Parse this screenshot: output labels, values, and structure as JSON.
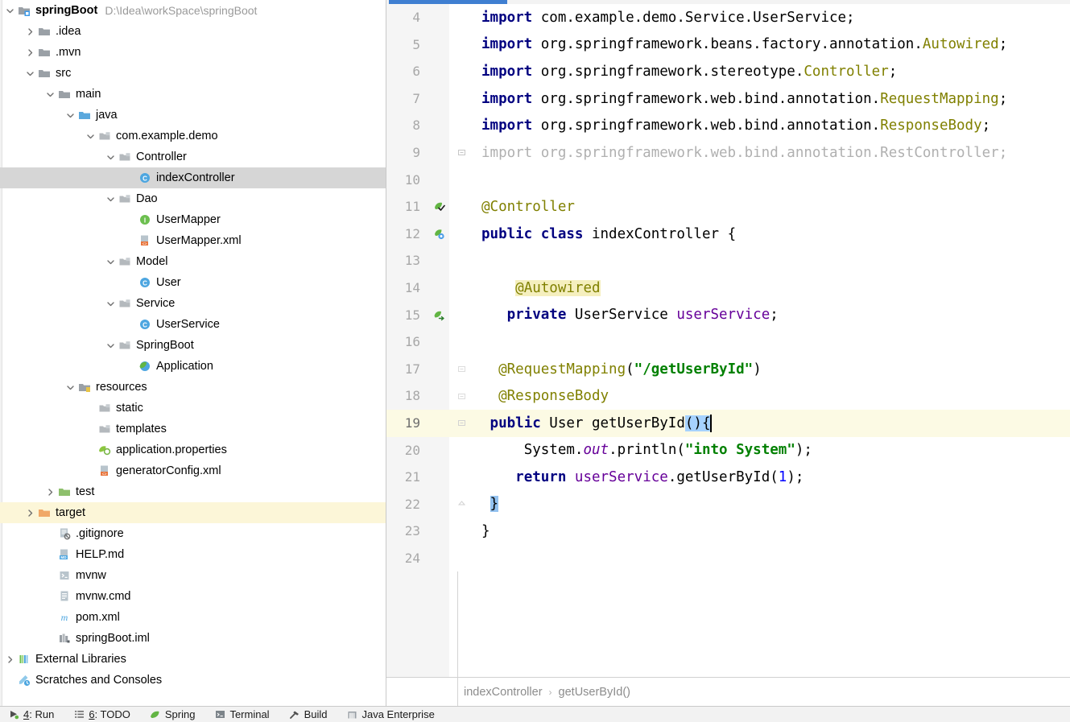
{
  "project": {
    "name": "springBoot",
    "path": "D:\\Idea\\workSpace\\springBoot",
    "tree": [
      {
        "label": ".idea",
        "indent": 1,
        "arrow": "right",
        "icon": "folder-grey"
      },
      {
        "label": ".mvn",
        "indent": 1,
        "arrow": "right",
        "icon": "folder-grey"
      },
      {
        "label": "src",
        "indent": 1,
        "arrow": "down",
        "icon": "folder-grey"
      },
      {
        "label": "main",
        "indent": 2,
        "arrow": "down",
        "icon": "folder-grey"
      },
      {
        "label": "java",
        "indent": 3,
        "arrow": "down",
        "icon": "folder-source"
      },
      {
        "label": "com.example.demo",
        "indent": 4,
        "arrow": "down",
        "icon": "package"
      },
      {
        "label": "Controller",
        "indent": 5,
        "arrow": "down",
        "icon": "package"
      },
      {
        "label": "indexController",
        "indent": 6,
        "arrow": "none",
        "icon": "class",
        "selected": true
      },
      {
        "label": "Dao",
        "indent": 5,
        "arrow": "down",
        "icon": "package"
      },
      {
        "label": "UserMapper",
        "indent": 6,
        "arrow": "none",
        "icon": "interface"
      },
      {
        "label": "UserMapper.xml",
        "indent": 6,
        "arrow": "none",
        "icon": "xml"
      },
      {
        "label": "Model",
        "indent": 5,
        "arrow": "down",
        "icon": "package"
      },
      {
        "label": "User",
        "indent": 6,
        "arrow": "none",
        "icon": "class"
      },
      {
        "label": "Service",
        "indent": 5,
        "arrow": "down",
        "icon": "package"
      },
      {
        "label": "UserService",
        "indent": 6,
        "arrow": "none",
        "icon": "class"
      },
      {
        "label": "SpringBoot",
        "indent": 5,
        "arrow": "down",
        "icon": "package"
      },
      {
        "label": "Application",
        "indent": 6,
        "arrow": "none",
        "icon": "spring-class"
      },
      {
        "label": "resources",
        "indent": 3,
        "arrow": "down",
        "icon": "folder-resources"
      },
      {
        "label": "static",
        "indent": 4,
        "arrow": "none",
        "icon": "package"
      },
      {
        "label": "templates",
        "indent": 4,
        "arrow": "none",
        "icon": "package"
      },
      {
        "label": "application.properties",
        "indent": 4,
        "arrow": "none",
        "icon": "spring-properties"
      },
      {
        "label": "generatorConfig.xml",
        "indent": 4,
        "arrow": "none",
        "icon": "xml"
      },
      {
        "label": "test",
        "indent": 2,
        "arrow": "right",
        "icon": "folder-test"
      },
      {
        "label": "target",
        "indent": 1,
        "arrow": "right",
        "icon": "folder-orange",
        "excluded": true
      },
      {
        "label": ".gitignore",
        "indent": 2,
        "arrow": "none",
        "icon": "gitignore"
      },
      {
        "label": "HELP.md",
        "indent": 2,
        "arrow": "none",
        "icon": "markdown"
      },
      {
        "label": "mvnw",
        "indent": 2,
        "arrow": "none",
        "icon": "script"
      },
      {
        "label": "mvnw.cmd",
        "indent": 2,
        "arrow": "none",
        "icon": "text-file"
      },
      {
        "label": "pom.xml",
        "indent": 2,
        "arrow": "none",
        "icon": "maven"
      },
      {
        "label": "springBoot.iml",
        "indent": 2,
        "arrow": "none",
        "icon": "module"
      },
      {
        "label": "External Libraries",
        "indent": 0,
        "arrow": "right",
        "icon": "libraries"
      },
      {
        "label": "Scratches and Consoles",
        "indent": 0,
        "arrow": "none",
        "icon": "scratches"
      }
    ]
  },
  "editor": {
    "lines": [
      {
        "num": "4",
        "fold": "none",
        "gutter": "none"
      },
      {
        "num": "5",
        "fold": "none",
        "gutter": "none"
      },
      {
        "num": "6",
        "fold": "none",
        "gutter": "none"
      },
      {
        "num": "7",
        "fold": "none",
        "gutter": "none"
      },
      {
        "num": "8",
        "fold": "none",
        "gutter": "none"
      },
      {
        "num": "9",
        "fold": "collapse-top",
        "gutter": "none"
      },
      {
        "num": "10",
        "fold": "none",
        "gutter": "none"
      },
      {
        "num": "11",
        "fold": "none",
        "gutter": "spring-bean-check"
      },
      {
        "num": "12",
        "fold": "none",
        "gutter": "spring-bean"
      },
      {
        "num": "13",
        "fold": "none",
        "gutter": "none"
      },
      {
        "num": "14",
        "fold": "none",
        "gutter": "none"
      },
      {
        "num": "15",
        "fold": "none",
        "gutter": "spring-autowire"
      },
      {
        "num": "16",
        "fold": "none",
        "gutter": "none"
      },
      {
        "num": "17",
        "fold": "minus",
        "gutter": "none"
      },
      {
        "num": "18",
        "fold": "minus",
        "gutter": "none"
      },
      {
        "num": "19",
        "fold": "minus",
        "gutter": "none",
        "current": true
      },
      {
        "num": "20",
        "fold": "none",
        "gutter": "none"
      },
      {
        "num": "21",
        "fold": "none",
        "gutter": "none"
      },
      {
        "num": "22",
        "fold": "end",
        "gutter": "none"
      },
      {
        "num": "23",
        "fold": "none",
        "gutter": "none"
      },
      {
        "num": "24",
        "fold": "none",
        "gutter": "none"
      }
    ],
    "code": {
      "l4": {
        "kw": "import",
        "rest": " com.example.demo.Service.UserService;"
      },
      "l5": {
        "kw": "import",
        "rest": " org.springframework.beans.factory.annotation.",
        "anno": "Autowired",
        "tail": ";"
      },
      "l6": {
        "kw": "import",
        "rest": " org.springframework.stereotype.",
        "anno": "Controller",
        "tail": ";"
      },
      "l7": {
        "kw": "import",
        "rest": " org.springframework.web.bind.annotation.",
        "anno": "RequestMapping",
        "tail": ";"
      },
      "l8": {
        "kw": "import",
        "rest": " org.springframework.web.bind.annotation.",
        "anno": "ResponseBody",
        "tail": ";"
      },
      "l9": {
        "full": "import org.springframework.web.bind.annotation.RestController;"
      },
      "l11": {
        "anno": "@Controller"
      },
      "l12": {
        "kw1": "public",
        "kw2": "class",
        "name": " indexController {"
      },
      "l14": {
        "anno": "@Autowired"
      },
      "l15": {
        "kw": "private",
        "type": " UserService ",
        "field": "userService",
        "tail": ";"
      },
      "l17": {
        "anno": "@RequestMapping",
        "paren1": "(",
        "str": "\"/getUserById\"",
        "paren2": ")"
      },
      "l18": {
        "anno": "@ResponseBody"
      },
      "l19": {
        "kw": "public",
        "type": " User ",
        "method": "getUserById",
        "sel": "(){"
      },
      "l20": {
        "cls": "System.",
        "stat": "out",
        "call": ".println(",
        "str": "\"into System\"",
        "tail": ");"
      },
      "l21": {
        "kw": "return",
        "field": " userService",
        "call": ".getUserById(",
        "num": "1",
        "tail": ");"
      },
      "l22": {
        "brace": "}"
      },
      "l23": {
        "brace": "}"
      }
    },
    "breadcrumb": {
      "class_name": "indexController",
      "separator": "›",
      "method_name": "getUserById()"
    }
  },
  "statusbar": {
    "items": [
      {
        "icon": "run-icon",
        "key": "4",
        "label": ": Run"
      },
      {
        "icon": "todo-icon",
        "key": "6",
        "label": ": TODO"
      },
      {
        "icon": "spring-icon",
        "key": "",
        "label": "Spring"
      },
      {
        "icon": "terminal-icon",
        "key": "",
        "label": "Terminal"
      },
      {
        "icon": "build-hammer-icon",
        "key": "",
        "label": "Build"
      },
      {
        "icon": "java-enterprise-icon",
        "key": "",
        "label": "Java Enterprise"
      }
    ]
  }
}
